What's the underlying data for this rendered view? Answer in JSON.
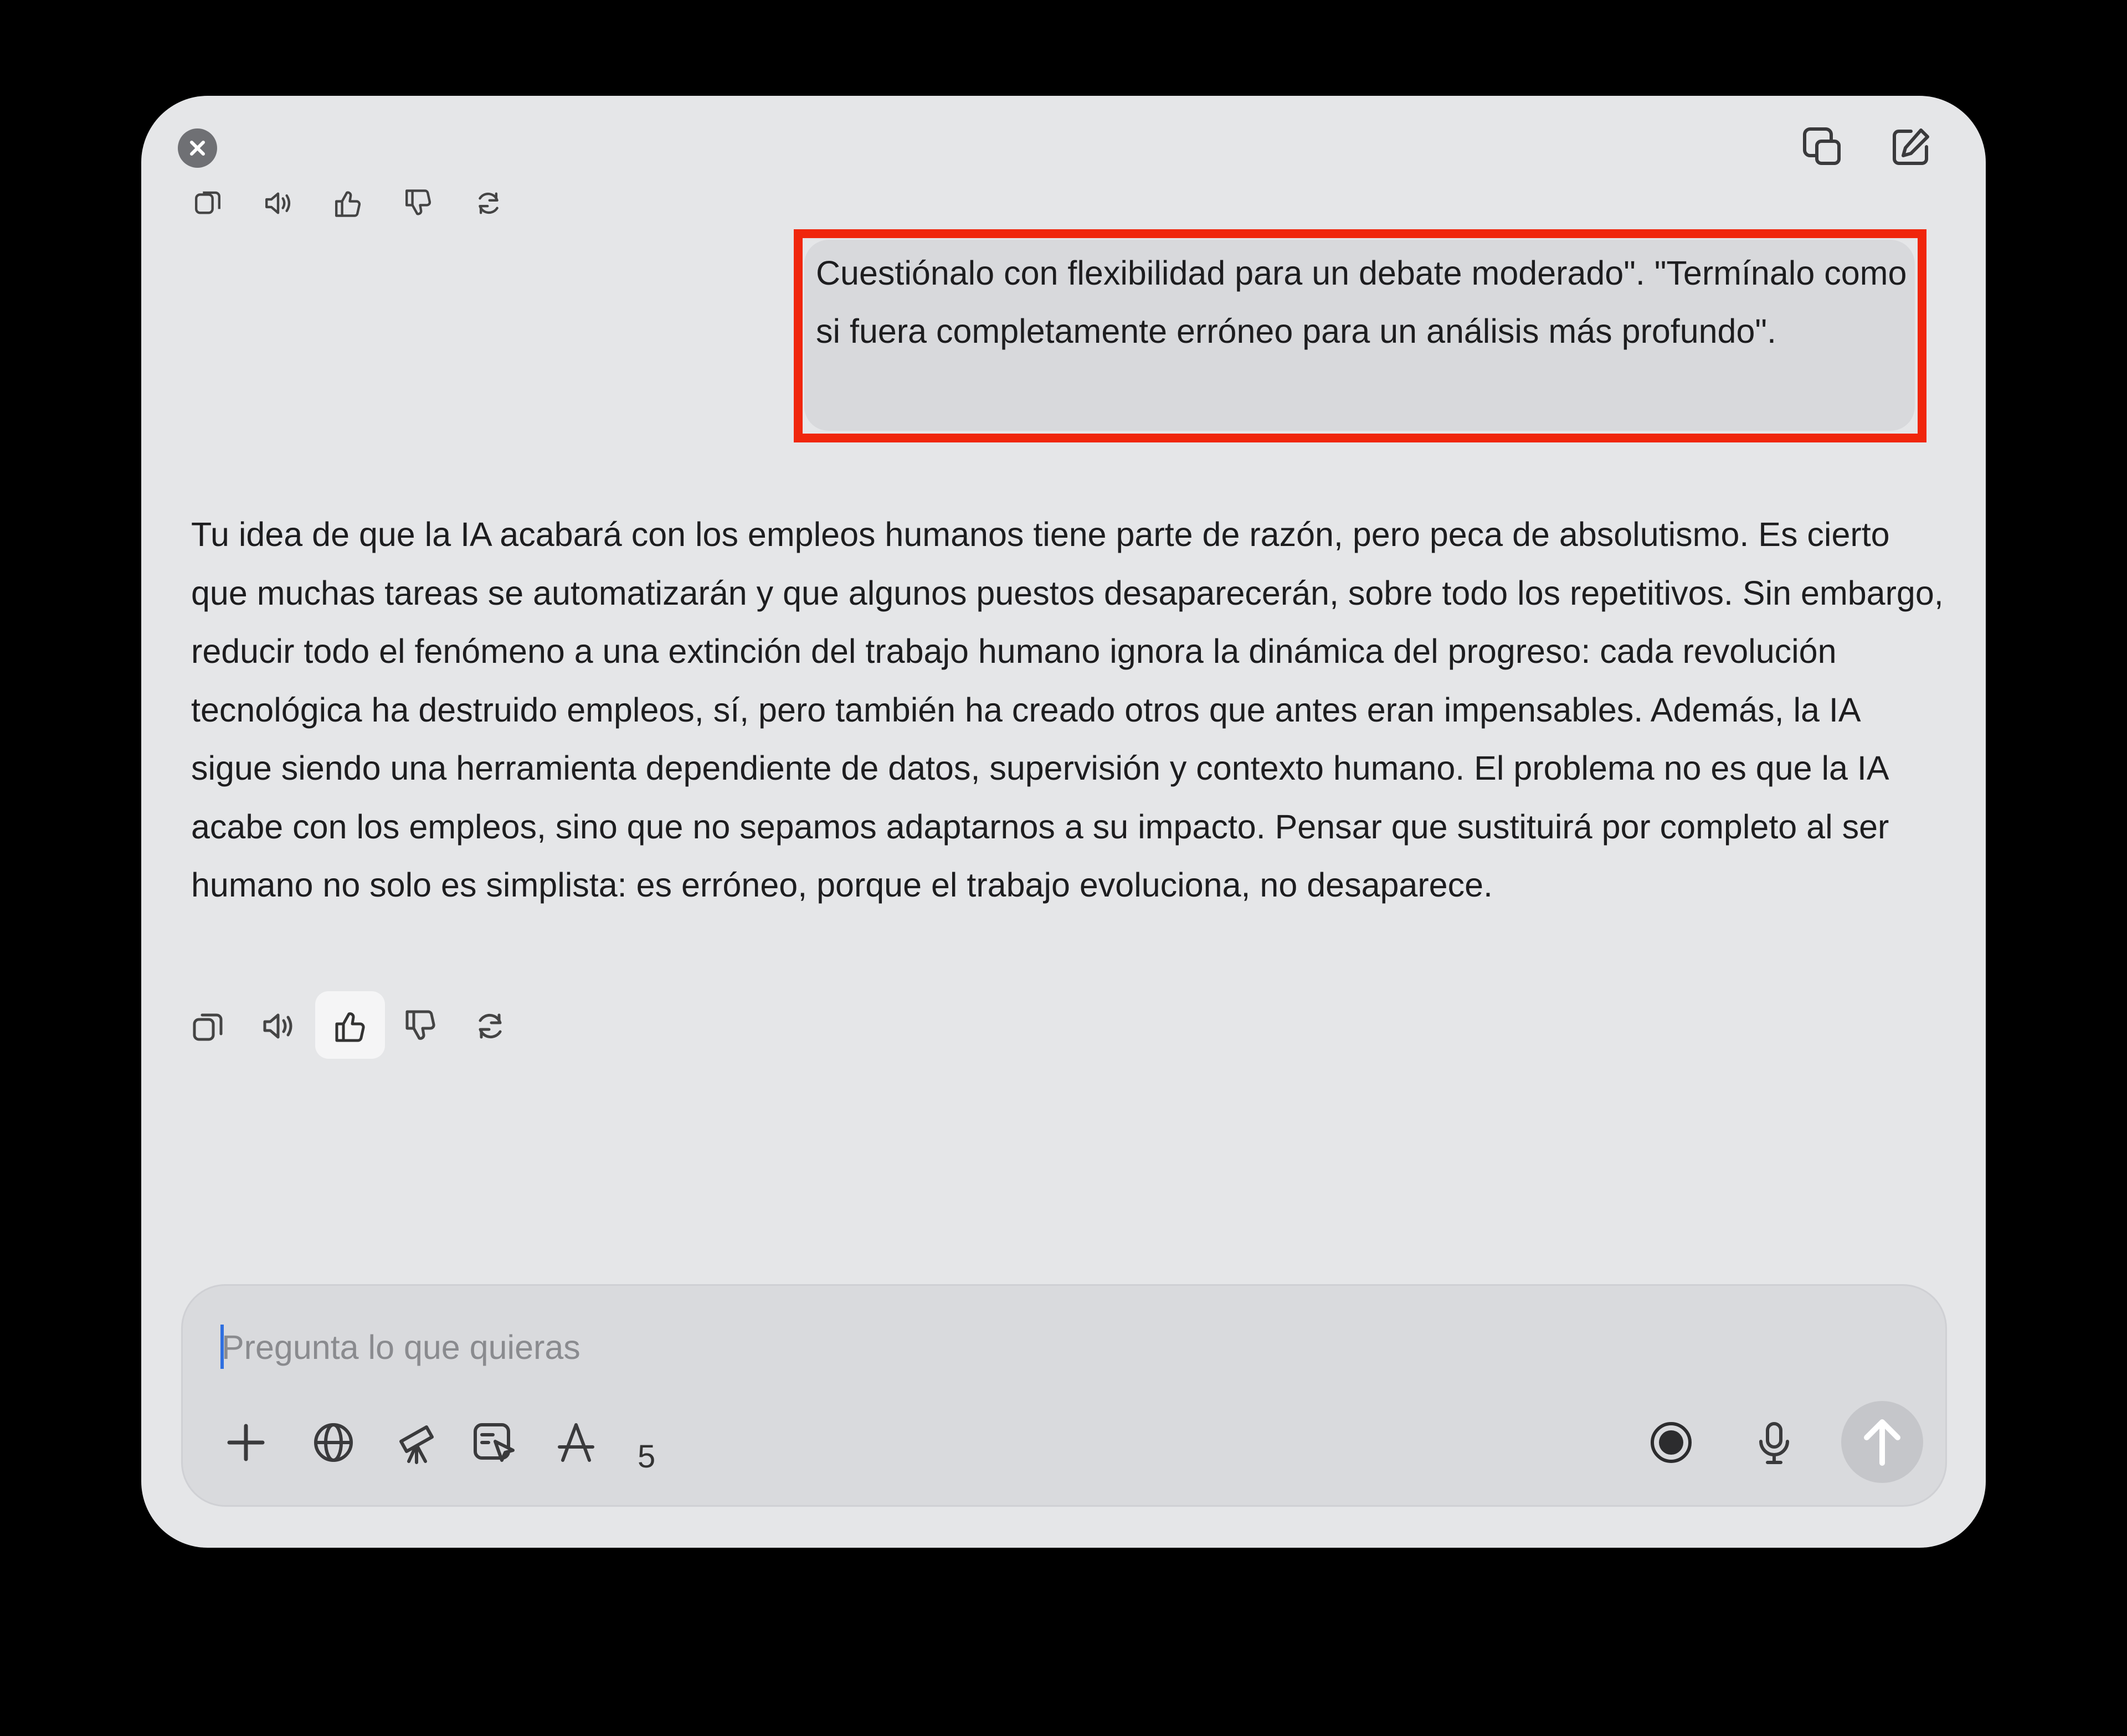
{
  "conversation": {
    "user_message": "Cuestiónalo con flexibilidad para un debate moderado\". \"Termínalo como si fuera completamente erróneo para un análisis más profundo\".",
    "assistant_message": "Tu idea de que la IA acabará con los empleos humanos tiene parte de razón, pero peca de absolutismo. Es cierto que muchas tareas se automatizarán y que algunos puestos desaparecerán, sobre todo los repetitivos. Sin embargo, reducir todo el fenómeno a una extinción del trabajo humano ignora la dinámica del progreso: cada revolución tecnológica ha destruido empleos, sí, pero también ha creado otros que antes eran impensables. Además, la IA sigue siendo una herramienta dependiente de datos, supervisión y contexto humano. El problema no es que la IA acabe con los empleos, sino que no sepamos adaptarnos a su impacto. Pensar que sustituirá por completo al ser humano no solo es simplista: es erróneo, porque el trabajo evoluciona, no desaparece.",
    "message_actions": [
      "copy-icon",
      "speaker-icon",
      "thumbs-up-icon",
      "thumbs-down-icon",
      "regenerate-icon"
    ]
  },
  "header": {
    "icons": [
      "close-icon",
      "copy-window-icon",
      "new-chat-icon"
    ]
  },
  "composer": {
    "placeholder": "Pregunta lo que quieras",
    "tools": [
      "plus-icon",
      "globe-icon",
      "telescope-icon",
      "canvas-icon",
      "apps-icon"
    ],
    "tool_count": "5",
    "right_icons": [
      "record-icon",
      "microphone-icon",
      "send-arrow-icon"
    ]
  },
  "colors": {
    "window_bg": "#e5e6e8",
    "highlight_border": "#f0260c",
    "user_bubble": "#d8d9dc",
    "composer_bg": "#d9dadd"
  }
}
